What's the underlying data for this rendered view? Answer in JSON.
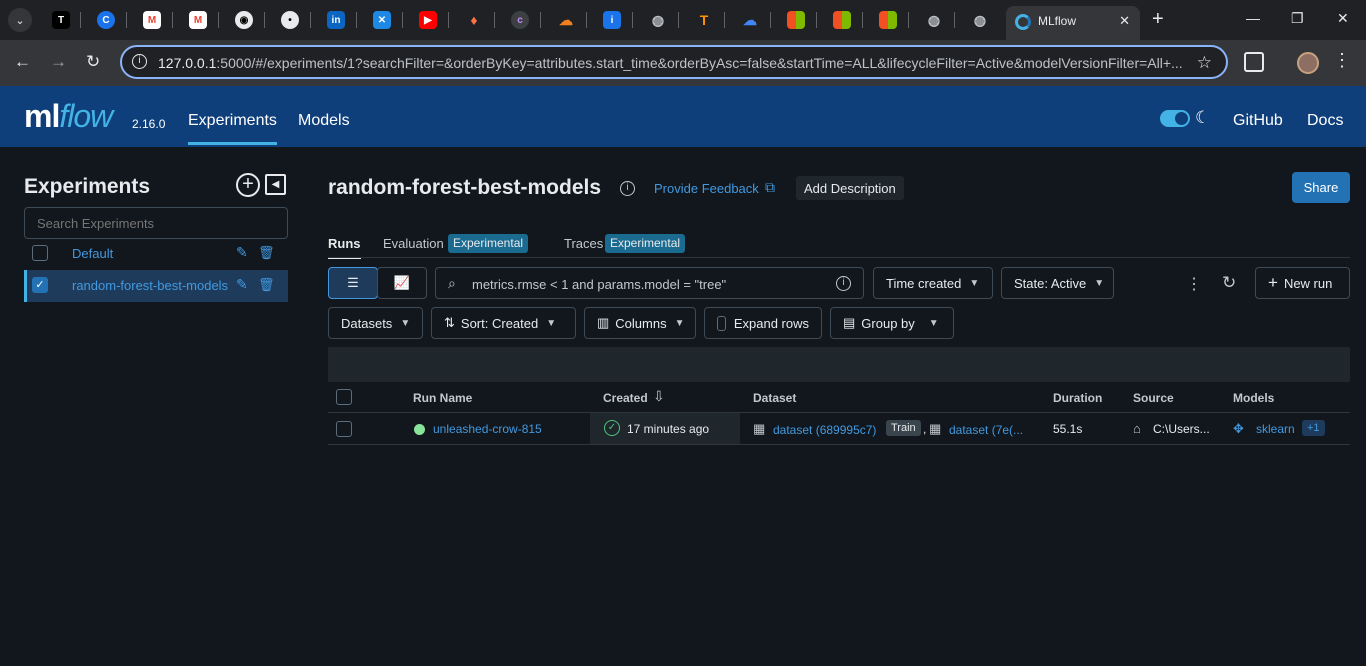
{
  "browser": {
    "tab_title": "MLflow",
    "url_host": "127.0.0.1",
    "url_path": ":5000/#/experiments/1?searchFilter=&orderByKey=attributes.start_time&orderByAsc=false&startTime=ALL&lifecycleFilter=Active&modelVersionFilter=All+..."
  },
  "header": {
    "logo_ml": "ml",
    "logo_flow": "flow",
    "version": "2.16.0",
    "nav": [
      "Experiments",
      "Models"
    ],
    "links": [
      "GitHub",
      "Docs"
    ]
  },
  "sidebar": {
    "title": "Experiments",
    "search_placeholder": "Search Experiments",
    "items": [
      {
        "label": "Default",
        "checked": false
      },
      {
        "label": "random-forest-best-models",
        "checked": true
      }
    ]
  },
  "main": {
    "title": "random-forest-best-models",
    "feedback": "Provide Feedback",
    "add_description": "Add Description",
    "share": "Share",
    "tabs": {
      "runs": "Runs",
      "evaluation": "Evaluation",
      "traces": "Traces",
      "experimental": "Experimental"
    },
    "controls": {
      "search_placeholder": "metrics.rmse < 1 and params.model = \"tree\"",
      "time": "Time created",
      "state": "State: Active",
      "new_run": "New run",
      "datasets": "Datasets",
      "sort": "Sort: Created",
      "columns": "Columns",
      "expand": "Expand rows",
      "group": "Group by"
    },
    "table": {
      "headers": [
        "Run Name",
        "Created",
        "Dataset",
        "Duration",
        "Source",
        "Models"
      ],
      "rows": [
        {
          "run_name": "unleashed-crow-815",
          "created": "17 minutes ago",
          "dataset1": "dataset (689995c7)",
          "dataset_tag": "Train",
          "dataset2": "dataset (7e(...",
          "duration": "55.1s",
          "source": "C:\\Users...",
          "model": "sklearn",
          "more_models": "+1"
        }
      ]
    }
  },
  "colors": {
    "header_bg": "#0e3f7a",
    "accent": "#43b3e6",
    "link": "#4299e0",
    "primary_button": "#2272b4"
  }
}
